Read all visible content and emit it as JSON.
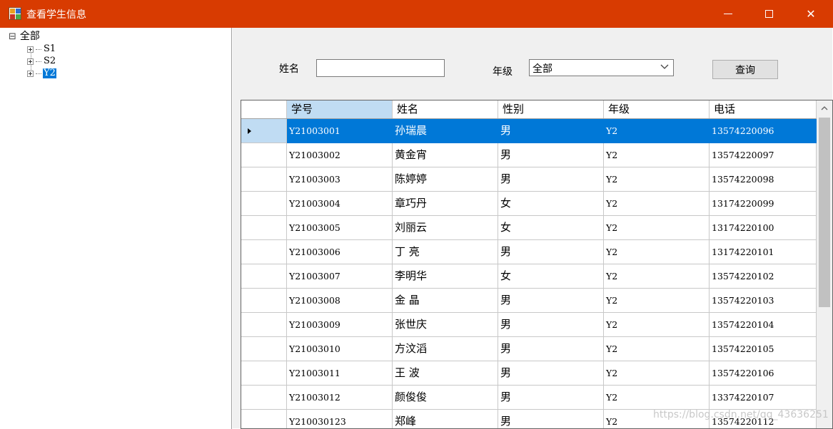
{
  "window": {
    "title": "查看学生信息",
    "icon": "app-form-icon",
    "controls": {
      "minimize": "minimize-icon",
      "maximize": "maximize-icon",
      "close": "✕"
    },
    "accent": "#d83b01"
  },
  "tree": {
    "root": {
      "label": "全部",
      "expander": "⊟"
    },
    "children": [
      {
        "label": "S1",
        "selected": false
      },
      {
        "label": "S2",
        "selected": false
      },
      {
        "label": "Y2",
        "selected": true
      }
    ]
  },
  "filters": {
    "name_label": "姓名",
    "name_value": "",
    "grade_label": "年级",
    "grade_value": "全部",
    "query_button": "查询"
  },
  "grid": {
    "columns": [
      "学号",
      "姓名",
      "性别",
      "年级",
      "电话"
    ],
    "selected_row": 0,
    "rows": [
      [
        "Y21003001",
        "孙瑞晨",
        "男",
        "Y2",
        "13574220096"
      ],
      [
        "Y21003002",
        "黄金宵",
        "男",
        "Y2",
        "13574220097"
      ],
      [
        "Y21003003",
        "陈婷婷",
        "男",
        "Y2",
        "13574220098"
      ],
      [
        "Y21003004",
        "章巧丹",
        "女",
        "Y2",
        "13174220099"
      ],
      [
        "Y21003005",
        "刘丽云",
        "女",
        "Y2",
        "13174220100"
      ],
      [
        "Y21003006",
        "丁 亮",
        "男",
        "Y2",
        "13174220101"
      ],
      [
        "Y21003007",
        "李明华",
        "女",
        "Y2",
        "13574220102"
      ],
      [
        "Y21003008",
        " 金 晶",
        "男",
        "Y2",
        "13574220103"
      ],
      [
        "Y21003009",
        "张世庆",
        "男",
        "Y2",
        "13574220104"
      ],
      [
        "Y21003010",
        "方汶滔",
        "男",
        "Y2",
        "13574220105"
      ],
      [
        "Y21003011",
        "王 波",
        "男",
        "Y2",
        "13574220106"
      ],
      [
        "Y21003012",
        "颜俊俊",
        "男",
        "Y2",
        "13374220107"
      ],
      [
        "Y210030123",
        "郑峰",
        "男",
        "Y2",
        "13574220112"
      ]
    ]
  },
  "watermark": "https://blog.csdn.net/qq_43636251"
}
